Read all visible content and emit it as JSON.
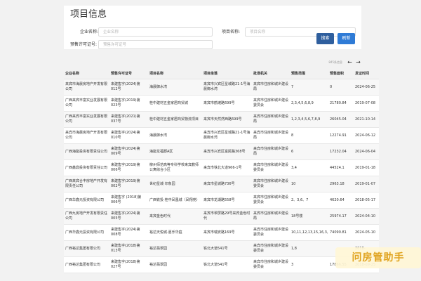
{
  "search": {
    "title": "项目信息",
    "company_label": "企业名称:",
    "company_placeholder": "企业名称",
    "project_label": "项目名称:",
    "project_placeholder": "项目名称",
    "permit_label": "预售许可证号:",
    "permit_placeholder": "预售许可证号",
    "search_button": "搜索",
    "reset_button": "刷新"
  },
  "results": {
    "count_text": "845条信息",
    "prev_icon": "←",
    "next_icon": "→"
  },
  "table": {
    "headers": [
      "企业名称",
      "预售许可证号",
      "项目名称",
      "项目坐落",
      "批准机关",
      "预售范围",
      "预售面积",
      "发证时间"
    ],
    "rows": [
      [
        "来宾市海晨房地产开发有限公司",
        "来建售字(2024)第012号",
        "海晨御水湾",
        "来宾市兴宾区星城路21-1号海晨御水湾",
        "来宾市住房和城乡建设局",
        "7",
        "0",
        "2024-06-25"
      ],
      [
        "广西来宾丰富实业发展有限公司",
        "来建售字(2019)第023号",
        "桂中建材五金家居商贸城",
        "来宾市鹤滩路699号",
        "来宾市住房和城乡建设委员会",
        "2,3,4,5,6,8,9",
        "21780.84",
        "2019-07-08"
      ],
      [
        "广西来宾丰富实业发展有限公司",
        "来建售字(2021)第037号",
        "桂中建材五金家居商贸物流项目",
        "来宾市天然然西路699号",
        "来宾市住房和城乡建设局",
        "1,2,3,4,5,6,7,8,9",
        "26045.04",
        "2021-10-14"
      ],
      [
        "来宾市海晨房地产开发有限公司",
        "来建售字(2024)第010号",
        "海晨御水湾",
        "来宾市兴宾区星城路21-1号海晨御水湾",
        "来宾市住房和城乡建设局",
        "8",
        "12274.91",
        "2024-06-12"
      ],
      [
        "广西海能投资有限责任公司",
        "来建售字(2024)第009号",
        "海能龙福郡A区",
        "来宾市兴宾区富民路368号",
        "来宾市住房和城乡建设局",
        "6",
        "17232.04",
        "2024-06-04"
      ],
      [
        "广西鑫鼎投资有限责任公司",
        "来建售字(2019)第006号",
        "柳州师范高等专科学校来宾教师公寓综合小区",
        "来宾市铁北大道966-1号",
        "来宾市住房和城乡建设委员会",
        "3,4",
        "44524.1",
        "2019-01-18"
      ],
      [
        "广西来宾合丰房地产开发有限责任公司",
        "来建售字(2019)第002号",
        "世纪星城·印象园",
        "来宾市星城路736号",
        "来宾市住房和城乡建设委员会",
        "10",
        "2963.18",
        "2019-01-07"
      ],
      [
        "广西华鑫元投资有限公司",
        "来建售字 (2018)第006号",
        "广西铁投·桂中凤凰城（凤翔苑）",
        "来宾市龙湖路558号",
        "来宾市住房和城乡建设委员会",
        "2、3,6、7",
        "4620.64",
        "2018-05-17"
      ],
      [
        "广西九房地产开发有限责任公司",
        "来建售字(2024)第005号",
        "来宾金色时代",
        "来宾市翠屏路29号来宾金色时代",
        "来宾市住房和城乡建设局",
        "18号楼",
        "25974.17",
        "2024-04-10"
      ],
      [
        "广西华鑫元投资有限公司",
        "来建售字(2024)第008号",
        "裕达天悦城·嘉乐华庭",
        "来宾市瑞安路169号",
        "来宾市住房和城乡建设委员会",
        "10,11,12,13,15,16,3,5,6,8,9",
        "74090.81",
        "2024-05-10"
      ],
      [
        "广西裕达集团有限公司",
        "来建售字(2018)第013号",
        "裕达翡翠园",
        "铁北大道541号",
        "来宾市住房和城乡建设委员会",
        "1,8",
        "",
        "2018-"
      ],
      [
        "广西裕达集团有限公司",
        "来建售字(2018)第027号",
        "裕达翡翠园",
        "铁北大道541号",
        "来宾市住房和城乡建设委员会",
        "3",
        "17866.55",
        "2018-09-25"
      ]
    ]
  },
  "watermark": {
    "text": "问房管助手"
  }
}
